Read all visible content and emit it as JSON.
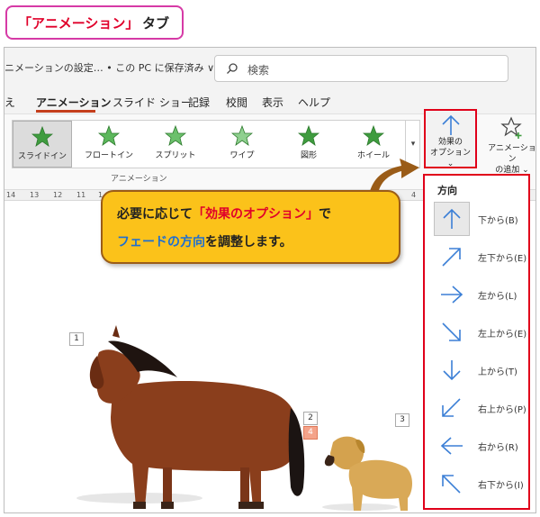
{
  "badge": {
    "title": "「アニメーション」",
    "suffix": "タブ"
  },
  "titlebar": {
    "filename": "ニメーションの設定… • この PC に保存済み ∨",
    "search_placeholder": "検索"
  },
  "tabs": [
    "え",
    "アニメーション",
    "スライド ショー",
    "記録",
    "校閲",
    "表示",
    "ヘルプ"
  ],
  "active_tab": "アニメーション",
  "gallery": {
    "items": [
      {
        "label": "スライドイン",
        "selected": true
      },
      {
        "label": "フロートイン",
        "selected": false
      },
      {
        "label": "スプリット",
        "selected": false
      },
      {
        "label": "ワイプ",
        "selected": false
      },
      {
        "label": "図形",
        "selected": false
      },
      {
        "label": "ホイール",
        "selected": false
      }
    ],
    "group_label": "アニメーション"
  },
  "effect_options": {
    "line1": "効果の",
    "line2": "オプション ⌄"
  },
  "add_animation": {
    "line1": "アニメーション",
    "line2": "の追加 ⌄"
  },
  "ruler": [
    "14",
    "13",
    "12",
    "11",
    "1"
  ],
  "ruler_right": "4",
  "callout": {
    "line1_pre": "必要に応じて",
    "line1_highlight": "「効果のオプション」",
    "line1_post": "で",
    "line2_highlight": "フェードの方向",
    "line2_post": "を調整します。"
  },
  "direction_menu": {
    "heading": "方向",
    "items": [
      {
        "label": "下から(B)",
        "icon": "arrow-up-icon",
        "selected": true
      },
      {
        "label": "左下から(E)",
        "icon": "arrow-up-right-icon",
        "selected": false
      },
      {
        "label": "左から(L)",
        "icon": "arrow-right-icon",
        "selected": false
      },
      {
        "label": "左上から(E)",
        "icon": "arrow-down-right-icon",
        "selected": false
      },
      {
        "label": "上から(T)",
        "icon": "arrow-down-icon",
        "selected": false
      },
      {
        "label": "右上から(P)",
        "icon": "arrow-down-left-icon",
        "selected": false
      },
      {
        "label": "右から(R)",
        "icon": "arrow-left-icon",
        "selected": false
      },
      {
        "label": "右下から(I)",
        "icon": "arrow-up-left-icon",
        "selected": false
      }
    ]
  },
  "slide_labels": [
    "1",
    "2",
    "4",
    "3"
  ],
  "colors": {
    "accent_red": "#e0001a",
    "callout_yellow": "#fbc21a",
    "highlight_blue": "#1e6fd1",
    "star_green": "#3f9c3f",
    "arrow_blue": "#3b7fd6"
  }
}
